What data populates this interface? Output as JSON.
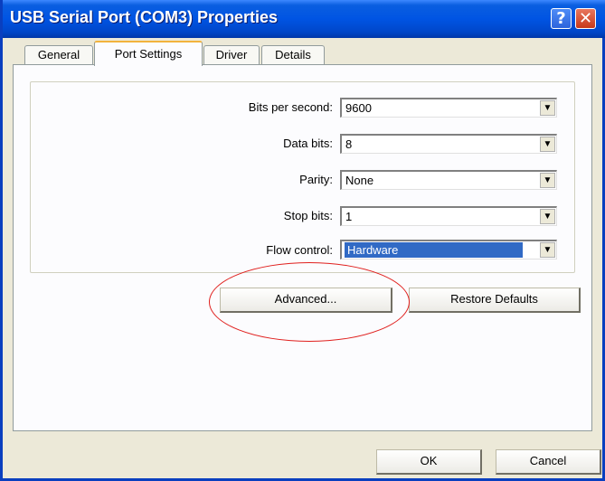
{
  "window": {
    "title": "USB Serial Port (COM3) Properties",
    "help_label": "?",
    "close_label": "✕"
  },
  "tabs": [
    {
      "label": "General"
    },
    {
      "label": "Port Settings"
    },
    {
      "label": "Driver"
    },
    {
      "label": "Details"
    }
  ],
  "settings": [
    {
      "label": "Bits per second:",
      "value": "9600"
    },
    {
      "label": "Data bits:",
      "value": "8"
    },
    {
      "label": "Parity:",
      "value": "None"
    },
    {
      "label": "Stop bits:",
      "value": "1"
    },
    {
      "label": "Flow control:",
      "value": "Hardware"
    }
  ],
  "buttons": {
    "advanced": "Advanced...",
    "restore_defaults": "Restore Defaults",
    "ok": "OK",
    "cancel": "Cancel"
  },
  "colors": {
    "title_bar": "#0054e3",
    "selection": "#316ac5",
    "highlight_circle": "#e0201e"
  }
}
